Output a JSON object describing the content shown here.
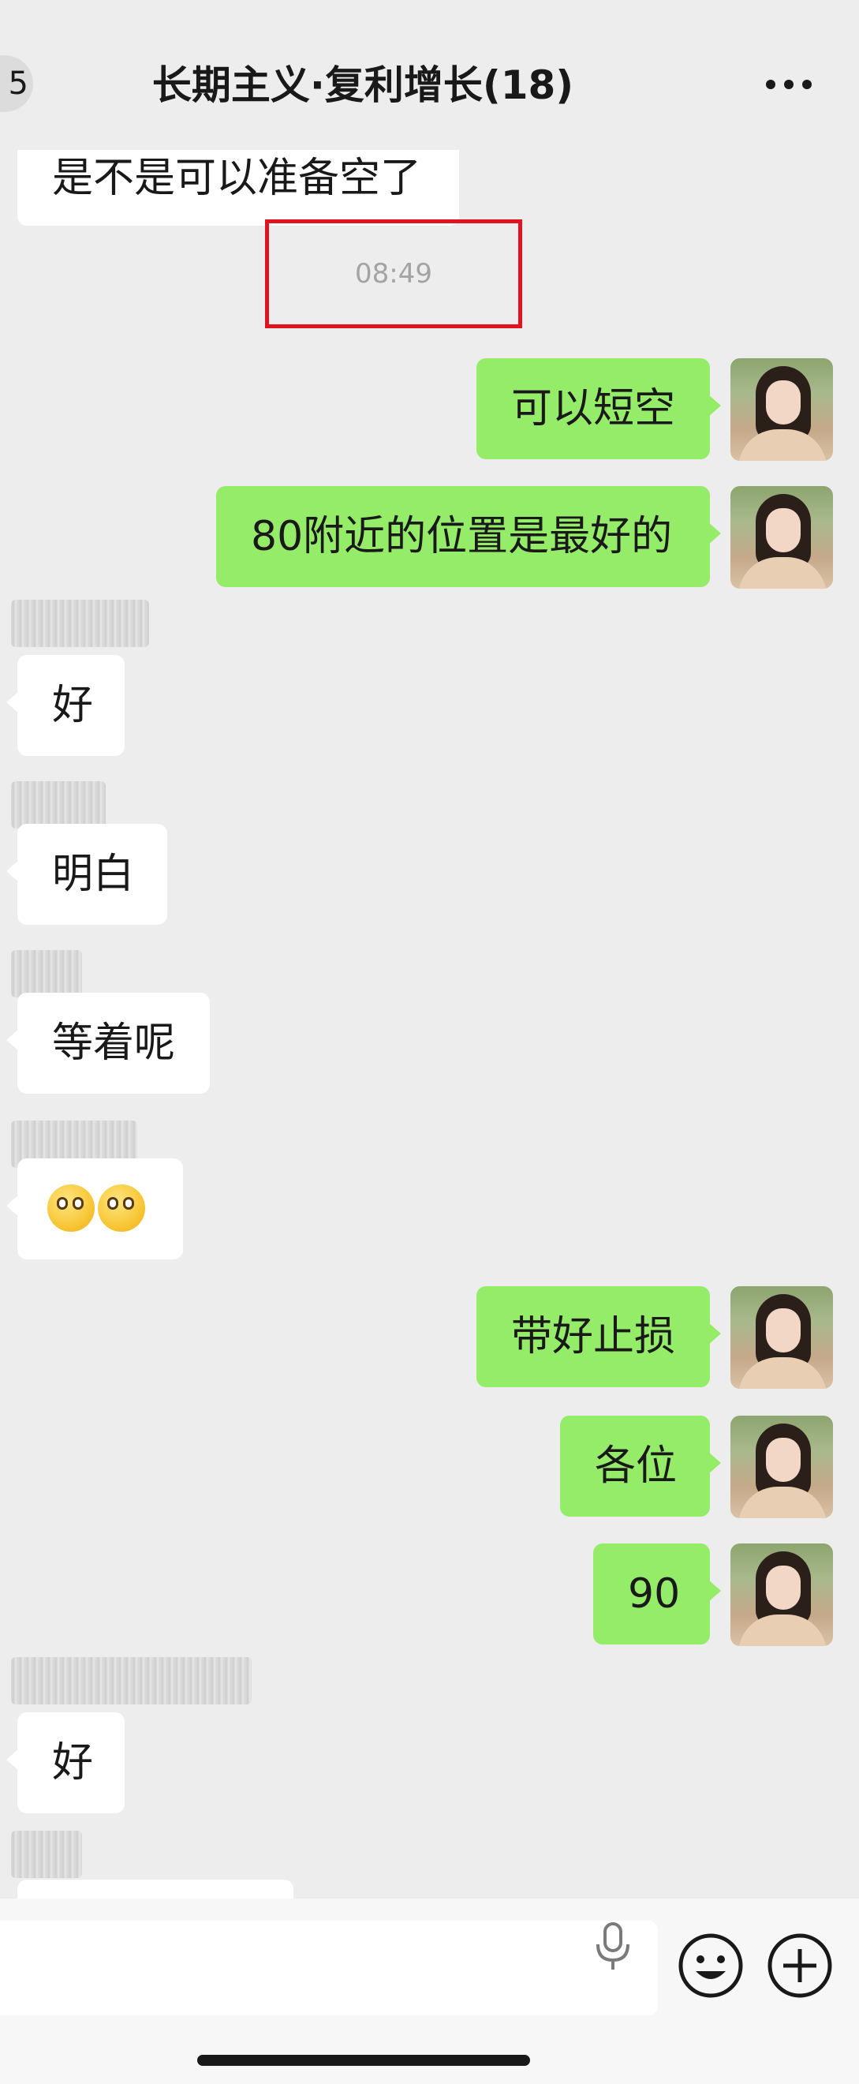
{
  "header": {
    "back_badge": "5",
    "title": "长期主义·复利增长(18)",
    "more": "..."
  },
  "timestamp": "08:49",
  "messages": [
    {
      "side": "in",
      "text": "是不是可以准备空了"
    },
    {
      "side": "out",
      "text": "可以短空"
    },
    {
      "side": "out",
      "text": "80附近的位置是最好的"
    },
    {
      "side": "in",
      "text": "好"
    },
    {
      "side": "in",
      "text": "明白"
    },
    {
      "side": "in",
      "text": "等着呢"
    },
    {
      "side": "in",
      "text": "",
      "emoji": [
        "emoji-face",
        "emoji-face"
      ]
    },
    {
      "side": "out",
      "text": "带好止损"
    },
    {
      "side": "out",
      "text": "各位"
    },
    {
      "side": "out",
      "text": "90"
    },
    {
      "side": "in",
      "text": "好"
    },
    {
      "side": "in",
      "text": ""
    }
  ],
  "icons": {
    "more": "ellipsis-icon",
    "mic": "microphone-icon",
    "emoji": "smiley-icon",
    "plus": "plus-icon"
  },
  "colors": {
    "background": "#ededed",
    "bubble_out": "#95ec69",
    "bubble_in": "#ffffff",
    "highlight_box": "#e0141e"
  }
}
